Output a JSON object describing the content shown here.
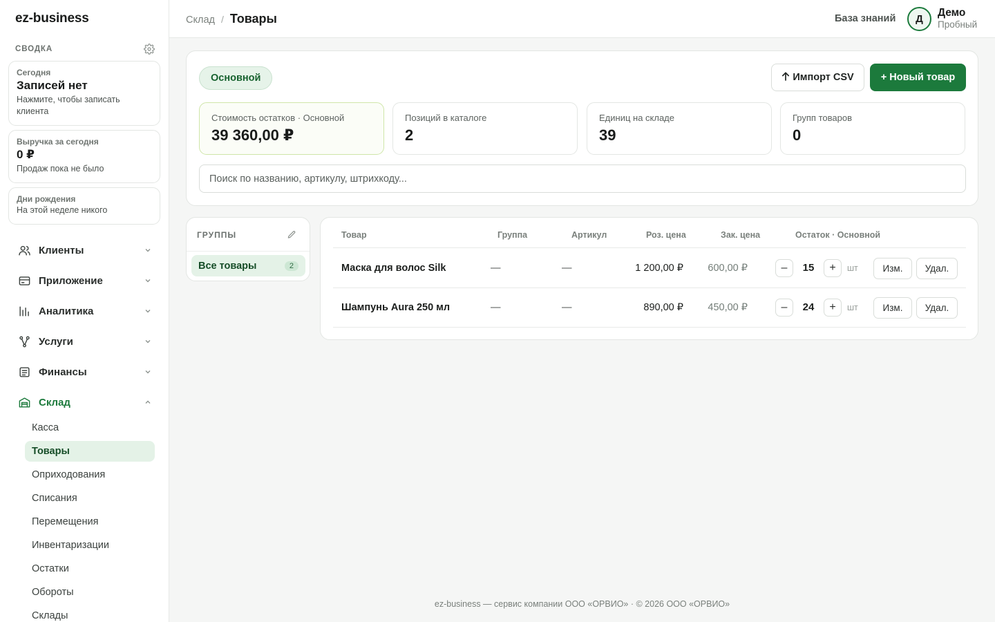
{
  "app": {
    "brand": "ez-business"
  },
  "sidebar": {
    "summary_title": "СВОДКА",
    "cards": {
      "today": {
        "label": "Сегодня",
        "value": "Записей нет",
        "hint": "Нажмите, чтобы записать клиента"
      },
      "revenue": {
        "label": "Выручка за сегодня",
        "value": "0 ₽",
        "hint": "Продаж пока не было"
      },
      "birthdays": {
        "label": "Дни рождения",
        "hint": "На этой неделе никого"
      }
    },
    "nav": {
      "clients": "Клиенты",
      "app": "Приложение",
      "analytics": "Аналитика",
      "services": "Услуги",
      "finance": "Финансы",
      "warehouse": "Склад"
    },
    "warehouse_sub": {
      "cash": "Касса",
      "products": "Товары",
      "receipts": "Оприходования",
      "writeoffs": "Списания",
      "transfers": "Перемещения",
      "inventory": "Инвентаризации",
      "stock": "Остатки",
      "turnover": "Обороты",
      "warehouses": "Склады"
    }
  },
  "header": {
    "breadcrumb_parent": "Склад",
    "breadcrumb_sep": "/",
    "title": "Товары",
    "knowledge_base": "База знаний",
    "avatar_initial": "Д",
    "user_name": "Демо",
    "user_plan": "Пробный"
  },
  "toolbar": {
    "warehouse": "Основной",
    "import_label": "Импорт CSV",
    "new_label": "+ Новый товар"
  },
  "stats": {
    "stock_value": {
      "label": "Стоимость остатков · Основной",
      "value": "39 360,00 ₽"
    },
    "catalog": {
      "label": "Позиций в каталоге",
      "value": "2"
    },
    "units": {
      "label": "Единиц на складе",
      "value": "39"
    },
    "groups": {
      "label": "Групп товаров",
      "value": "0"
    }
  },
  "search": {
    "placeholder": "Поиск по названию, артикулу, штрихкоду..."
  },
  "groups": {
    "title": "ГРУППЫ",
    "items": [
      {
        "label": "Все товары",
        "count": "2"
      }
    ]
  },
  "table": {
    "columns": {
      "product": "Товар",
      "group": "Группа",
      "article": "Артикул",
      "retail": "Роз. цена",
      "purchase": "Зак. цена",
      "stock": "Остаток · Основной"
    },
    "rows": [
      {
        "name": "Маска для волос Silk",
        "group": "—",
        "article": "—",
        "retail": "1 200,00 ₽",
        "purchase": "600,00 ₽",
        "qty": "15",
        "unit": "шт"
      },
      {
        "name": "Шампунь Aura 250 мл",
        "group": "—",
        "article": "—",
        "retail": "890,00 ₽",
        "purchase": "450,00 ₽",
        "qty": "24",
        "unit": "шт"
      }
    ],
    "actions": {
      "minus": "–",
      "plus": "+",
      "edit": "Изм.",
      "delete": "Удал."
    }
  },
  "footer": {
    "text": "ez-business — сервис компании ООО «ОРВИО» · © 2026 ООО «ОРВИО»"
  },
  "colors": {
    "accent": "#1c7a3c",
    "accent_light": "#e4f2e7",
    "background": "#f5f6f5"
  },
  "icons": {
    "settings": "gear-icon",
    "clients": "users-icon",
    "app": "card-icon",
    "analytics": "bar-chart-icon",
    "services": "share-nodes-icon",
    "finance": "receipt-icon",
    "warehouse": "warehouse-icon",
    "import": "arrow-up-icon",
    "edit_groups": "pencil-icon"
  }
}
